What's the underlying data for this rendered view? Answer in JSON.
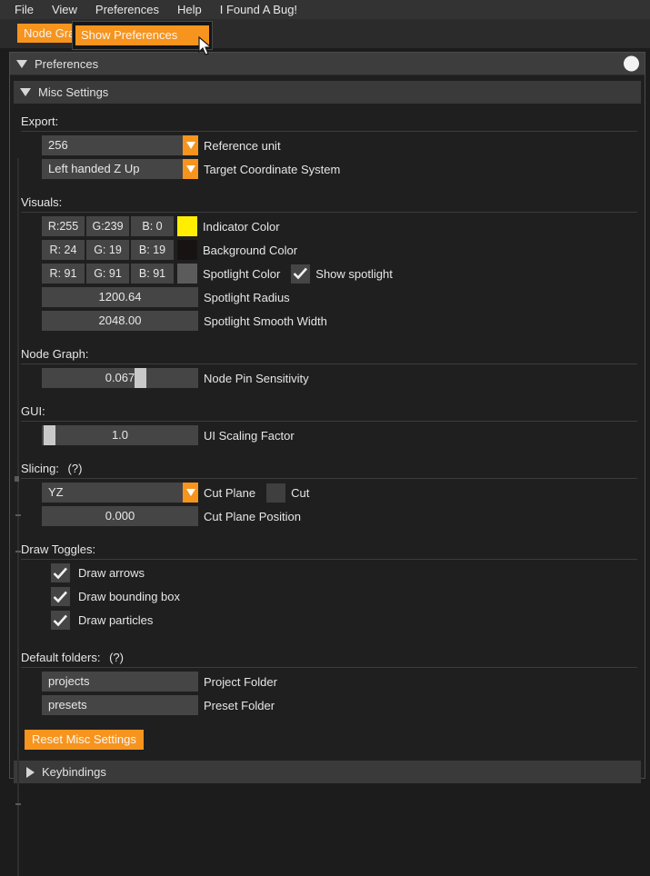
{
  "menubar": {
    "items": [
      {
        "label": "File"
      },
      {
        "label": "View"
      },
      {
        "label": "Preferences"
      },
      {
        "label": "Help"
      },
      {
        "label": "I Found A Bug!"
      }
    ]
  },
  "toolbar": {
    "tab_label": "Node Graph",
    "open_menu_item": "Show Preferences"
  },
  "panel": {
    "title": "Preferences",
    "subsection_title": "Misc Settings",
    "keybindings_title": "Keybindings",
    "reset_button": "Reset Misc Settings"
  },
  "groups": {
    "export": {
      "label": "Export:",
      "rows": [
        {
          "value": "256",
          "label": "Reference unit"
        },
        {
          "value": "Left handed Z Up",
          "label": "Target Coordinate System"
        }
      ]
    },
    "visuals": {
      "label": "Visuals:",
      "colors": [
        {
          "r": "R:255",
          "g": "G:239",
          "b": "B:  0",
          "swatch": "#ffee00",
          "label": "Indicator Color"
        },
        {
          "r": "R: 24",
          "g": "G: 19",
          "b": "B: 19",
          "swatch": "#181313",
          "label": "Background Color"
        },
        {
          "r": "R: 91",
          "g": "G: 91",
          "b": "B: 91",
          "swatch": "#5b5b5b",
          "label": "Spotlight Color"
        }
      ],
      "show_spotlight_label": "Show spotlight",
      "show_spotlight_checked": true,
      "sliders": [
        {
          "value": "1200.64",
          "label": "Spotlight Radius",
          "handle_pct": null
        },
        {
          "value": "2048.00",
          "label": "Spotlight Smooth Width",
          "handle_pct": null
        }
      ]
    },
    "node_graph": {
      "label": "Node Graph:",
      "sliders": [
        {
          "value": "0.067",
          "label": "Node Pin Sensitivity",
          "handle_pct": 64
        }
      ]
    },
    "gui": {
      "label": "GUI:",
      "sliders": [
        {
          "value": "1.0",
          "label": "UI Scaling Factor",
          "handle_pct": 1
        }
      ]
    },
    "slicing": {
      "label": "Slicing:",
      "help": "(?)",
      "cut_plane_value": "YZ",
      "cut_plane_label": "Cut Plane",
      "cut_label": "Cut",
      "cut_checked": false,
      "cut_position_value": "0.000",
      "cut_position_label": "Cut Plane Position"
    },
    "draw_toggles": {
      "label": "Draw Toggles:",
      "items": [
        {
          "label": "Draw arrows",
          "checked": true
        },
        {
          "label": "Draw bounding box",
          "checked": true
        },
        {
          "label": "Draw particles",
          "checked": true
        }
      ]
    },
    "default_folders": {
      "label": "Default folders:",
      "help": "(?)",
      "rows": [
        {
          "value": "projects",
          "label": "Project Folder"
        },
        {
          "value": "presets",
          "label": "Preset Folder"
        }
      ]
    }
  },
  "colors": {
    "accent": "#f7941e",
    "panel_bg": "#1f1f1f",
    "field_bg": "#454545",
    "text": "#e6e6e6"
  }
}
